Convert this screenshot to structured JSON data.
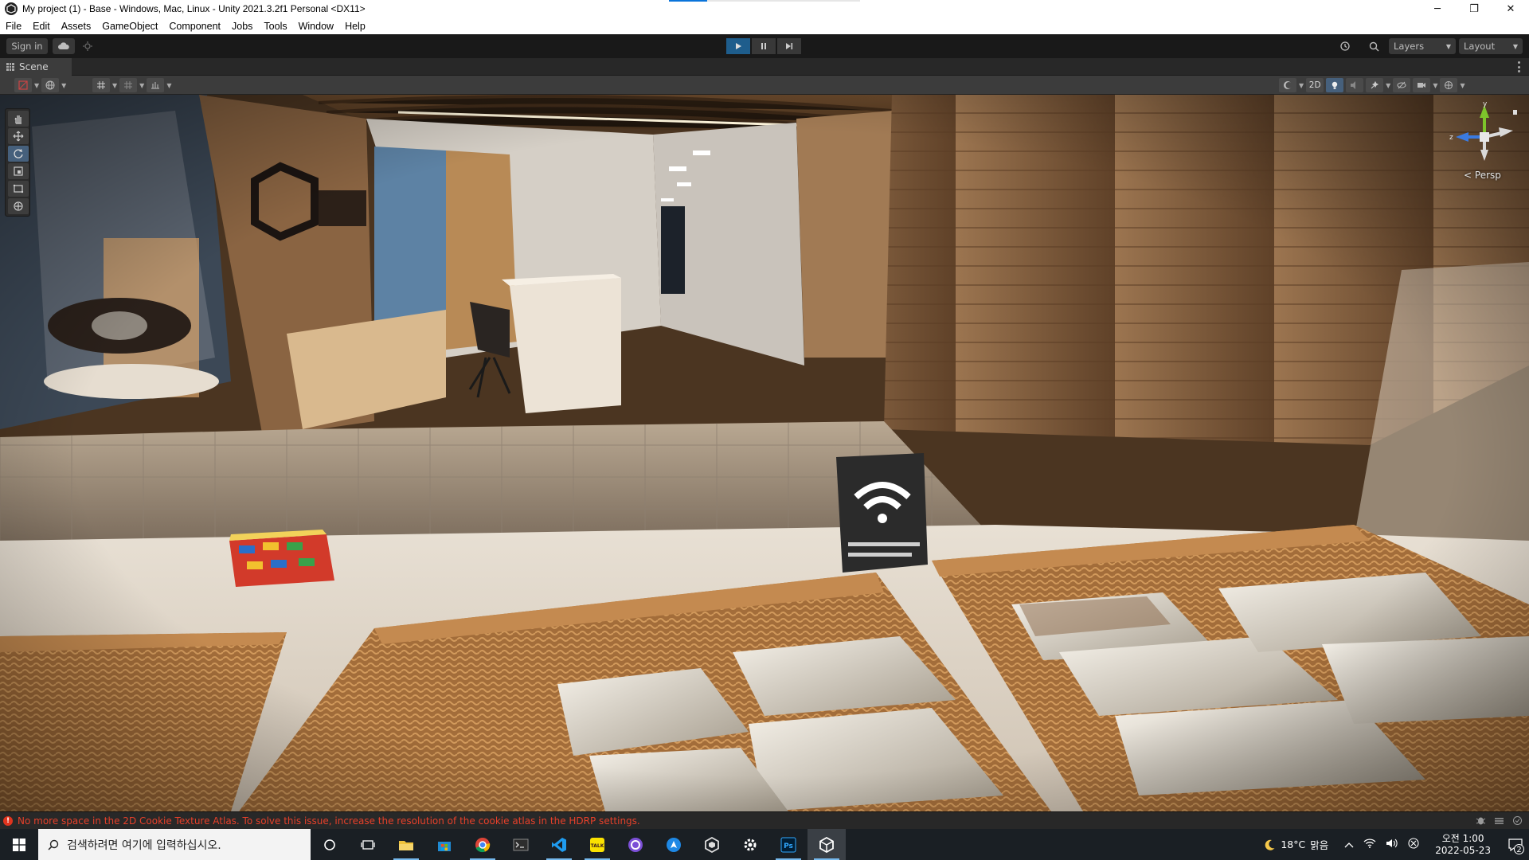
{
  "window": {
    "title": "My project (1) - Base - Windows, Mac, Linux - Unity 2021.3.2f1 Personal <DX11>",
    "controls": {
      "minimize": "─",
      "restore": "❐",
      "close": "✕"
    }
  },
  "menubar": {
    "items": [
      "File",
      "Edit",
      "Assets",
      "GameObject",
      "Component",
      "Jobs",
      "Tools",
      "Window",
      "Help"
    ]
  },
  "toolbar": {
    "sign_in_label": "Sign in",
    "layers_label": "Layers",
    "layout_label": "Layout",
    "play_state": "playing"
  },
  "scene_panel": {
    "tab_label": "Scene",
    "mode_2d_label": "2D",
    "projection_label": "Persp",
    "gizmo_axes": {
      "y": "y",
      "z": "z"
    }
  },
  "status": {
    "message": "No more space in the 2D Cookie Texture Atlas. To solve this issue, increase the resolution of the cookie atlas in the HDRP settings.",
    "error_color": "#e6402a"
  },
  "taskbar": {
    "search_placeholder": "검색하려면 여기에 입력하십시오.",
    "apps": [
      "cortana-icon",
      "task-view-icon",
      "file-explorer-icon",
      "microsoft-store-icon",
      "chrome-icon",
      "terminal-icon",
      "vscode-icon",
      "kakaotalk-icon",
      "github-desktop-icon",
      "unknown-blue-app-icon",
      "unity-hub-icon",
      "settings-icon",
      "photoshop-icon",
      "unity-editor-icon"
    ],
    "kakaotalk_label": "TALK",
    "photoshop_label": "Ps",
    "weather": {
      "temperature": "18°C",
      "condition": "맑음"
    },
    "clock": {
      "time": "오전 1:00",
      "date": "2022-05-23"
    },
    "notification_count": "2"
  },
  "colors": {
    "accent_blue": "#1e5d8c",
    "taskbar_bg": "#1a1f24",
    "editor_bg": "#191919"
  }
}
